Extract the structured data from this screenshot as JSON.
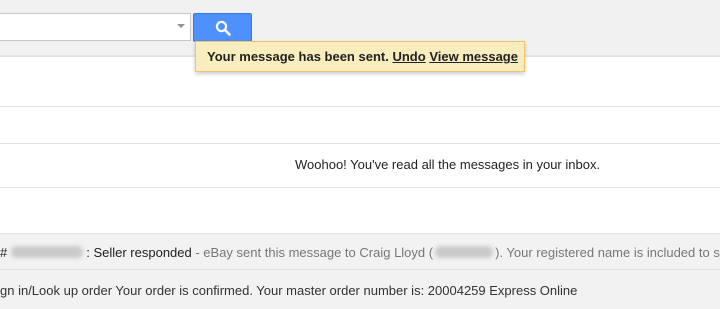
{
  "search": {
    "value": "",
    "placeholder": ""
  },
  "toast": {
    "message": "Your message has been sent.",
    "undo_label": "Undo",
    "view_label": "View message"
  },
  "inbox": {
    "empty_message": "Woohoo! You've read all the messages in your inbox."
  },
  "emails": [
    {
      "prefix": "#",
      "subject": ": Seller responded",
      "snippet_a": " - eBay sent this message to Craig Lloyd (",
      "snippet_b": "). Your registered name is included to show"
    },
    {
      "text": "gn in/Look up order Your order is confirmed. Your master order number is: 20004259 Express Online"
    }
  ]
}
